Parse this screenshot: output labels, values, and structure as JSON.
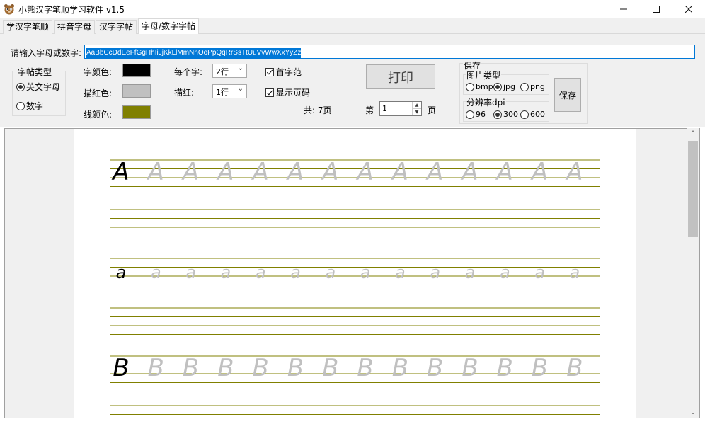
{
  "window": {
    "title": "小熊汉字笔顺学习软件 v1.5"
  },
  "tabs": [
    {
      "label": "学汉字笔顺"
    },
    {
      "label": "拼音字母"
    },
    {
      "label": "汉字字帖"
    },
    {
      "label": "字母/数字字帖",
      "active": true
    }
  ],
  "controls": {
    "input_label": "请输入字母或数字:",
    "input_value": "AaBbCcDdEeFfGgHhIiJjKkLlMmNnOoPpQqRrSsTtUuVvWwXxYyZz",
    "type_group": {
      "title": "字帖类型",
      "options": [
        "英文字母",
        "数字"
      ],
      "selected": "英文字母"
    },
    "char_color_label": "字颜色:",
    "trace_color_label": "描红色:",
    "line_color_label": "线颜色:",
    "colors": {
      "char": "#000000",
      "trace": "#c0c0c0",
      "line": "#808000"
    },
    "per_char_label": "每个字:",
    "per_char_value": "2行",
    "trace_label": "描红:",
    "trace_value": "1行",
    "first_char_label": "首字范",
    "show_page_label": "显示页码",
    "print_button": "打印",
    "total_pages": "共: 7页",
    "page_prefix": "第",
    "page_value": "1",
    "page_suffix": "页"
  },
  "save": {
    "title": "保存",
    "image_type_title": "图片类型",
    "image_types": [
      "bmp",
      "jpg",
      "png"
    ],
    "image_type_selected": "jpg",
    "dpi_title": "分辨率dpi",
    "dpis": [
      "96",
      "300",
      "600"
    ],
    "dpi_selected": "300",
    "save_button": "保存"
  },
  "preview": {
    "rows": [
      {
        "char": "A",
        "repeat": 13
      },
      {
        "char": "a",
        "repeat": 13
      },
      {
        "char": "B",
        "repeat": 13
      }
    ]
  }
}
